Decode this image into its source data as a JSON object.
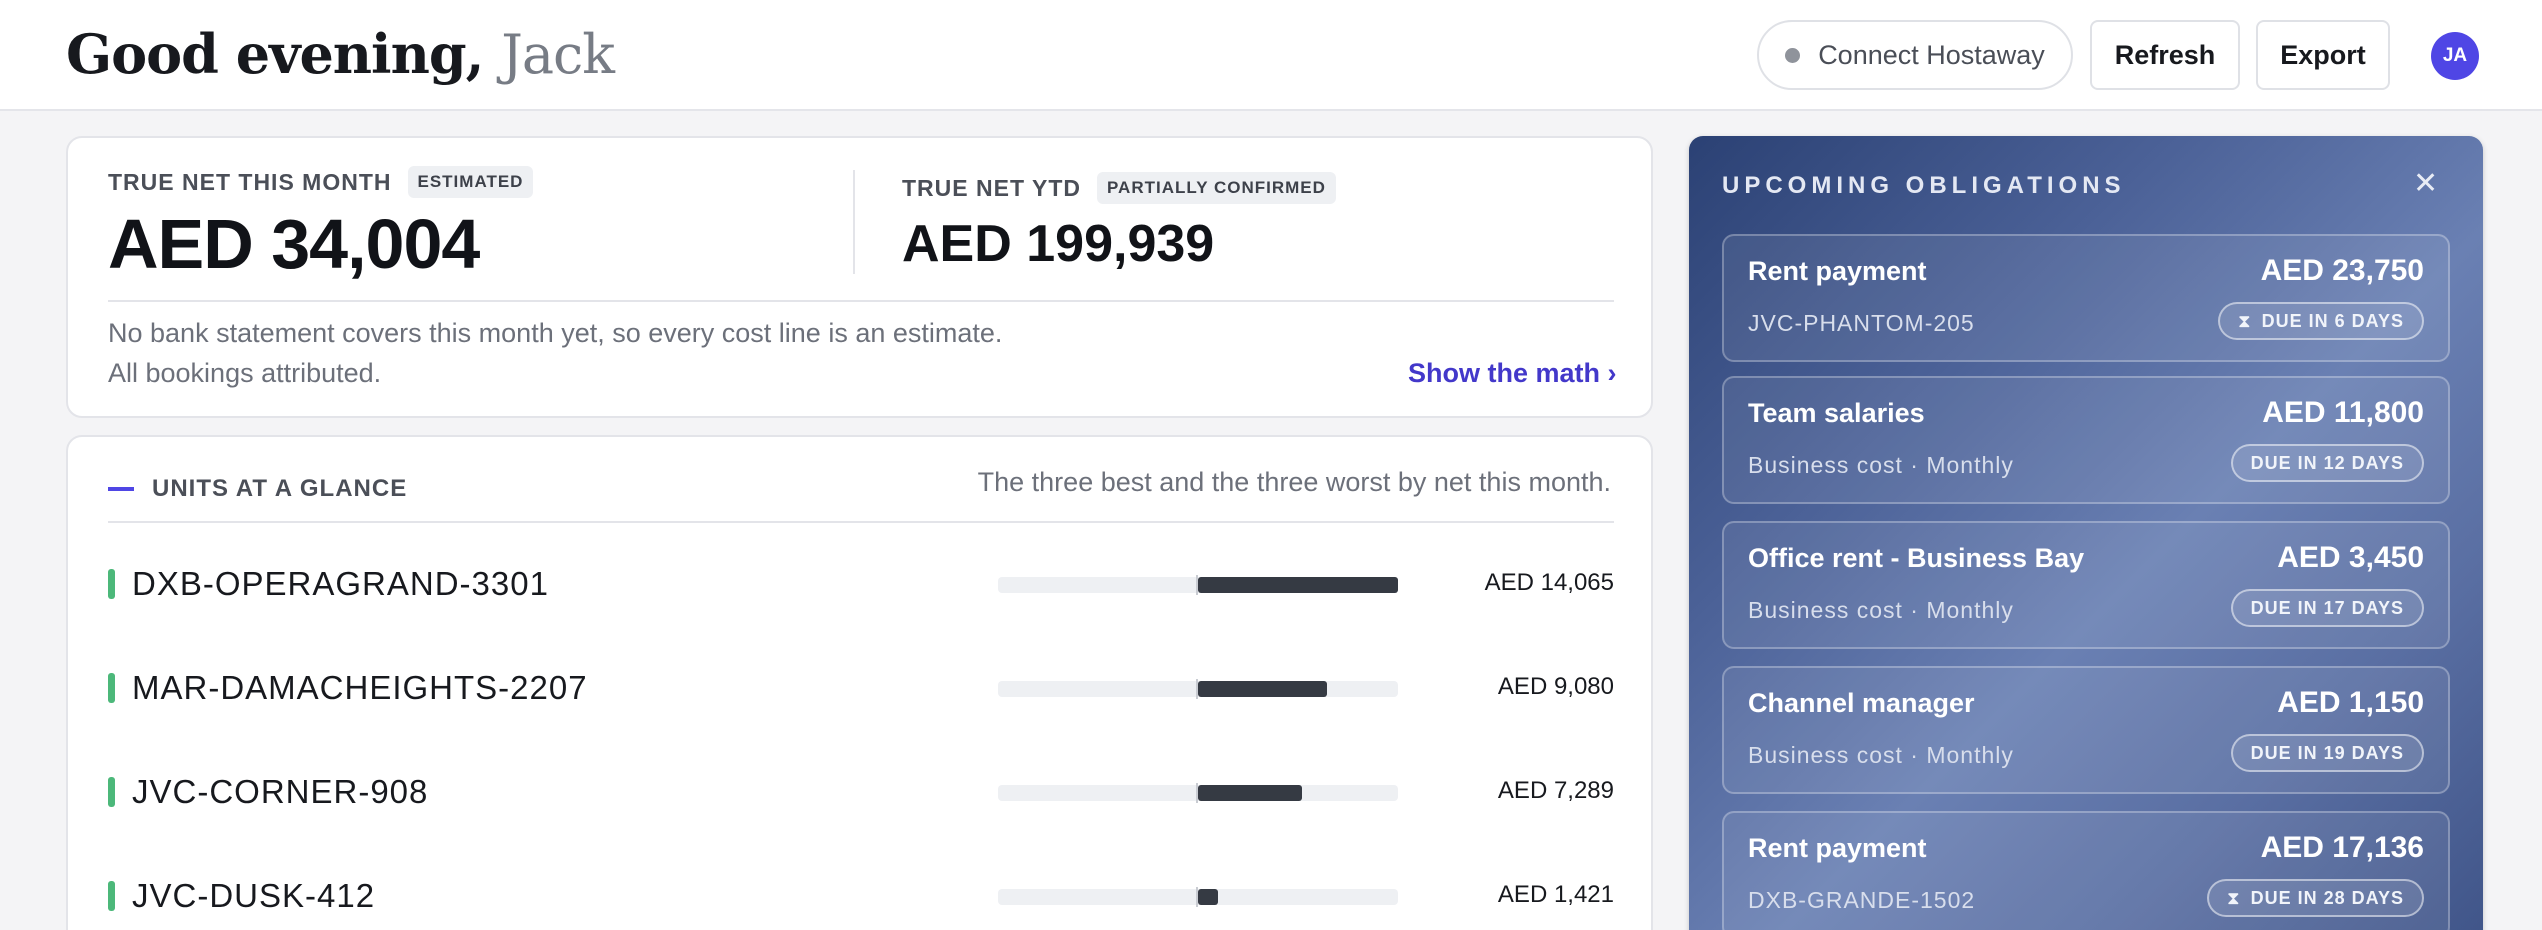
{
  "header": {
    "greeting": "Good evening,",
    "user_name": "Jack",
    "connect_label": "Connect Hostaway",
    "refresh_label": "Refresh",
    "export_label": "Export",
    "avatar_initials": "JA"
  },
  "summary": {
    "month_label": "TRUE NET THIS MONTH",
    "month_badge": "ESTIMATED",
    "month_value": "AED 34,004",
    "ytd_label": "TRUE NET YTD",
    "ytd_badge": "PARTIALLY CONFIRMED",
    "ytd_value": "AED 199,939",
    "note_line1": "No bank statement covers this month yet, so every cost line is an estimate.",
    "note_line2": "All bookings attributed.",
    "math_link": "Show the math ›"
  },
  "units": {
    "title": "UNITS AT A GLANCE",
    "subtitle": "The three best and the three worst by net this month.",
    "rows": [
      {
        "name": "DXB-OPERAGRAND-3301",
        "amount": "AED 14,065",
        "value": 14065
      },
      {
        "name": "MAR-DAMACHEIGHTS-2207",
        "amount": "AED 9,080",
        "value": 9080
      },
      {
        "name": "JVC-CORNER-908",
        "amount": "AED 7,289",
        "value": 7289
      },
      {
        "name": "JVC-DUSK-412",
        "amount": "AED 1,421",
        "value": 1421
      }
    ],
    "scale_max": 14065
  },
  "obligations": {
    "title": "UPCOMING OBLIGATIONS",
    "close_icon": "close-icon",
    "items": [
      {
        "title": "Rent payment",
        "amount": "AED 23,750",
        "sub": "JVC-PHANTOM-205",
        "due": "DUE IN 6 DAYS",
        "hourglass": true
      },
      {
        "title": "Team salaries",
        "amount": "AED 11,800",
        "sub": "Business cost · Monthly",
        "due": "DUE IN 12 DAYS",
        "hourglass": false
      },
      {
        "title": "Office rent - Business Bay",
        "amount": "AED 3,450",
        "sub": "Business cost · Monthly",
        "due": "DUE IN 17 DAYS",
        "hourglass": false
      },
      {
        "title": "Channel manager",
        "amount": "AED 1,150",
        "sub": "Business cost · Monthly",
        "due": "DUE IN 19 DAYS",
        "hourglass": false
      },
      {
        "title": "Rent payment",
        "amount": "AED 17,136",
        "sub": "DXB-GRANDE-1502",
        "due": "DUE IN 28 DAYS",
        "hourglass": true
      }
    ]
  },
  "colors": {
    "accent": "#4f46e5",
    "positive_marker": "#4cb87a",
    "bar_fill": "#353a43"
  }
}
